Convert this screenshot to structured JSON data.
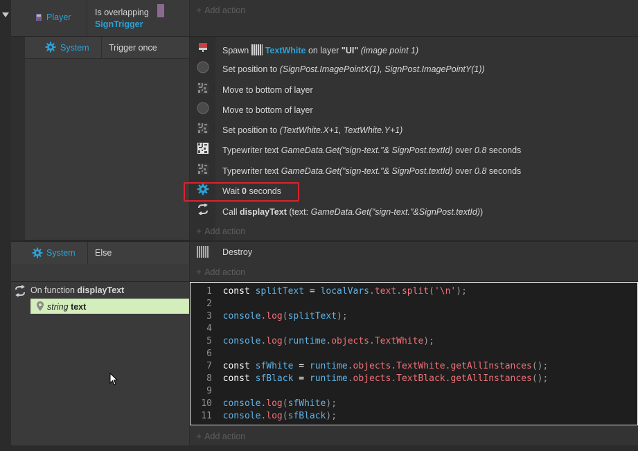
{
  "add_action_label": "Add action",
  "event1": {
    "object": "Player",
    "condition_text": "Is overlapping",
    "condition_target": "SignTrigger"
  },
  "subevent": {
    "object": "System",
    "condition": "Trigger once",
    "actions": [
      {
        "icon": "red-sprite-icon",
        "parts": [
          "Spawn ",
          "TextWhite",
          " on layer ",
          "\"UI\"",
          " (image point 1)"
        ]
      },
      {
        "icon": "gray-circle-icon",
        "parts": [
          "Set position to ",
          "(SignPost.ImagePointX(1), SignPost.ImagePointY(1))"
        ]
      },
      {
        "icon": "dark-text-icon",
        "text": "Move to bottom of layer"
      },
      {
        "icon": "gray-circle-icon",
        "text": "Move to bottom of layer"
      },
      {
        "icon": "dark-text-icon",
        "parts": [
          "Set position to ",
          "(TextWhite.X+1, TextWhite.Y+1)"
        ]
      },
      {
        "icon": "white-text-icon",
        "parts": [
          "Typewriter text ",
          "GameData.Get(\"sign-text.\"& SignPost.textId)",
          " over ",
          "0.8",
          " seconds"
        ]
      },
      {
        "icon": "dark-text-icon",
        "parts": [
          "Typewriter text ",
          "GameData.Get(\"sign-text.\"& SignPost.textId)",
          " over ",
          "0.8",
          " seconds"
        ]
      },
      {
        "icon": "gear-icon",
        "parts": [
          "Wait ",
          "0",
          " seconds"
        ],
        "highlighted": true
      },
      {
        "icon": "call-function-icon",
        "parts": [
          "Call ",
          "displayText",
          " (text: ",
          "GameData.Get(\"sign-text.\"&SignPost.textId)",
          ")"
        ]
      }
    ]
  },
  "else_event": {
    "object": "System",
    "condition": "Else",
    "action": "Destroy"
  },
  "function": {
    "label": "On function",
    "name": "displayText",
    "param_type": "string",
    "param_name": "text"
  },
  "code_lines": [
    "const splitText = localVars.text.split('\\n');",
    "",
    "console.log(splitText);",
    "",
    "console.log(runtime.objects.TextWhite);",
    "",
    "const sfWhite = runtime.objects.TextWhite.getAllInstances();",
    "const sfBlack = runtime.objects.TextBlack.getAllInstances();",
    "",
    "console.log(sfWhite);",
    "console.log(sfBlack);"
  ],
  "line_numbers": [
    "1",
    "2",
    "3",
    "4",
    "5",
    "6",
    "7",
    "8",
    "9",
    "10",
    "11"
  ],
  "colors": {
    "highlight_box": "#d9232d",
    "param_bg": "#d4edbc",
    "accent_blue": "#2aa3d9"
  }
}
